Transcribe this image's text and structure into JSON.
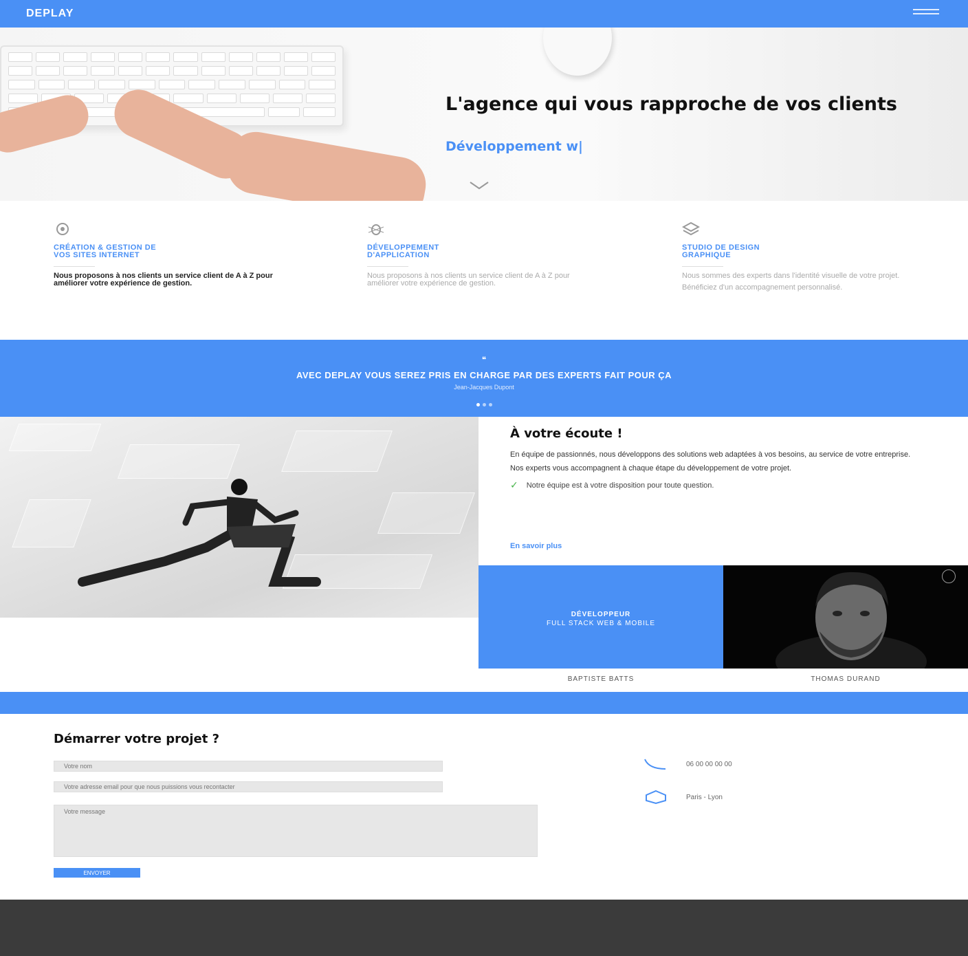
{
  "nav": {
    "logo": "DEPLAY",
    "menu_icon": "hamburger-icon"
  },
  "hero": {
    "title": "L'agence qui vous rapproche de vos clients",
    "typed_text": "Développement w|",
    "scroll_icon": "chevron-down-icon"
  },
  "services": [
    {
      "icon": "gear-icon",
      "title_line1": "CRÉATION & GESTION DE",
      "title_line2": "VOS SITES INTERNET",
      "text": "Nous proposons à nos clients un service client de A à Z pour améliorer votre expérience de gestion."
    },
    {
      "icon": "bug-icon",
      "title_line1": "DÉVELOPPEMENT",
      "title_line2": "D'APPLICATION",
      "text": "Nous proposons à nos clients un service client de A à Z pour améliorer votre expérience de gestion."
    },
    {
      "icon": "layers-icon",
      "title_line1": "STUDIO DE DESIGN",
      "title_line2": "GRAPHIQUE",
      "text": "Nous sommes des experts dans l'identité visuelle de votre projet.",
      "text2": "Bénéficiez d'un accompagnement personnalisé."
    }
  ],
  "testimonial": {
    "quote_icon": "quote-icon",
    "quote": "AVEC DEPLAY VOUS SEREZ PRIS EN CHARGE PAR DES EXPERTS FAIT POUR ÇA",
    "author": "Jean-Jacques Dupont",
    "dots": 3
  },
  "team": {
    "title": "À votre écoute !",
    "p1": "En équipe de passionnés, nous développons des solutions web adaptées à vos besoins, au service de votre entreprise.",
    "p2": "Nos experts vous accompagnent à chaque étape du développement de votre projet.",
    "check": "Notre équipe est à votre disposition pour toute question.",
    "more_link": "En savoir plus",
    "card_role_line1": "DÉVELOPPEUR",
    "card_role_line2": "FULL STACK WEB & MOBILE",
    "member1": "BAPTISTE BATTS",
    "member2": "THOMAS DURAND"
  },
  "contact": {
    "title": "Démarrer votre projet ?",
    "name_placeholder": "Votre nom",
    "email_placeholder": "Votre adresse email pour que nous puissions vous recontacter",
    "message_placeholder": "Votre message",
    "submit_label": "ENVOYER",
    "phone": "06 00 00 00 00",
    "address": "Paris - Lyon"
  },
  "colors": {
    "accent": "#4a90f5",
    "footer": "#3b3b3b"
  }
}
